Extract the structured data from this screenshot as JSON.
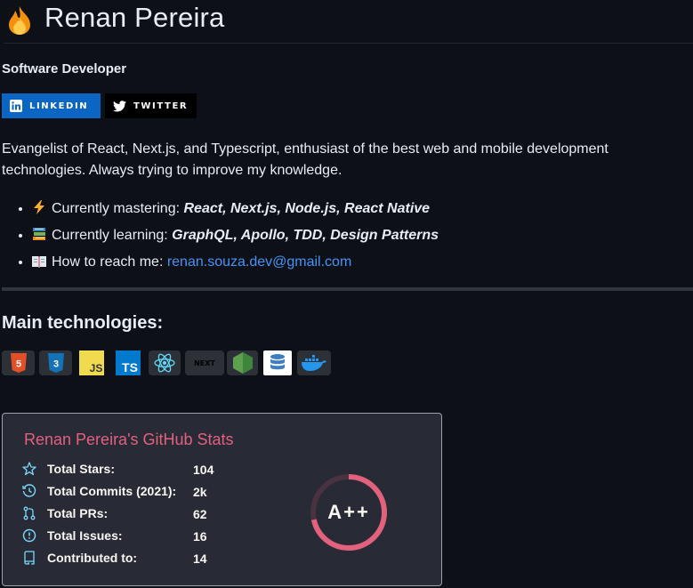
{
  "profile": {
    "name": "Renan Pereira",
    "subtitle": "Software Developer",
    "badges": [
      {
        "label": "LINKEDIN",
        "icon": "linkedin-icon",
        "color": "#0a66c2"
      },
      {
        "label": "TWITTER",
        "icon": "twitter-icon",
        "color": "#000000"
      }
    ],
    "about": "Evangelist of React, Next.js, and Typescript, enthusiast of the best web and mobile development technologies. Always trying to improve my knowledge.",
    "list": [
      {
        "icon": "lightning-icon",
        "label": "Currently mastering: ",
        "value": "React, Next.js, Node.js, React Native"
      },
      {
        "icon": "books-icon",
        "label": "Currently learning: ",
        "value": "GraphQL, Apollo, TDD, Design Patterns"
      },
      {
        "icon": "open-book-icon",
        "label": "How to reach me: ",
        "value": "renan.souza.dev@gmail.com"
      }
    ]
  },
  "technologies": {
    "heading": "Main technologies:",
    "items": [
      {
        "icon": "html5-icon",
        "text": "5"
      },
      {
        "icon": "css3-icon",
        "text": "3"
      },
      {
        "icon": "javascript-icon",
        "text": "JS"
      },
      {
        "icon": "typescript-icon",
        "text": "TS"
      },
      {
        "icon": "react-icon",
        "text": ""
      },
      {
        "icon": "nextjs-icon",
        "text": "NEXT"
      },
      {
        "icon": "nodejs-icon",
        "text": ""
      },
      {
        "icon": "database-icon",
        "text": ""
      },
      {
        "icon": "docker-icon",
        "text": ""
      }
    ]
  },
  "stats_card": {
    "title": "Renan Pereira's GitHub Stats",
    "grade": "A++",
    "accent": "#e2617d",
    "rows": [
      {
        "icon": "star-icon",
        "label": "Total Stars:",
        "value": "104"
      },
      {
        "icon": "history-icon",
        "label": "Total Commits (2021):",
        "value": "2k"
      },
      {
        "icon": "pull-request-icon",
        "label": "Total PRs:",
        "value": "62"
      },
      {
        "icon": "issue-icon",
        "label": "Total Issues:",
        "value": "16"
      },
      {
        "icon": "repo-icon",
        "label": "Contributed to:",
        "value": "14"
      }
    ]
  }
}
